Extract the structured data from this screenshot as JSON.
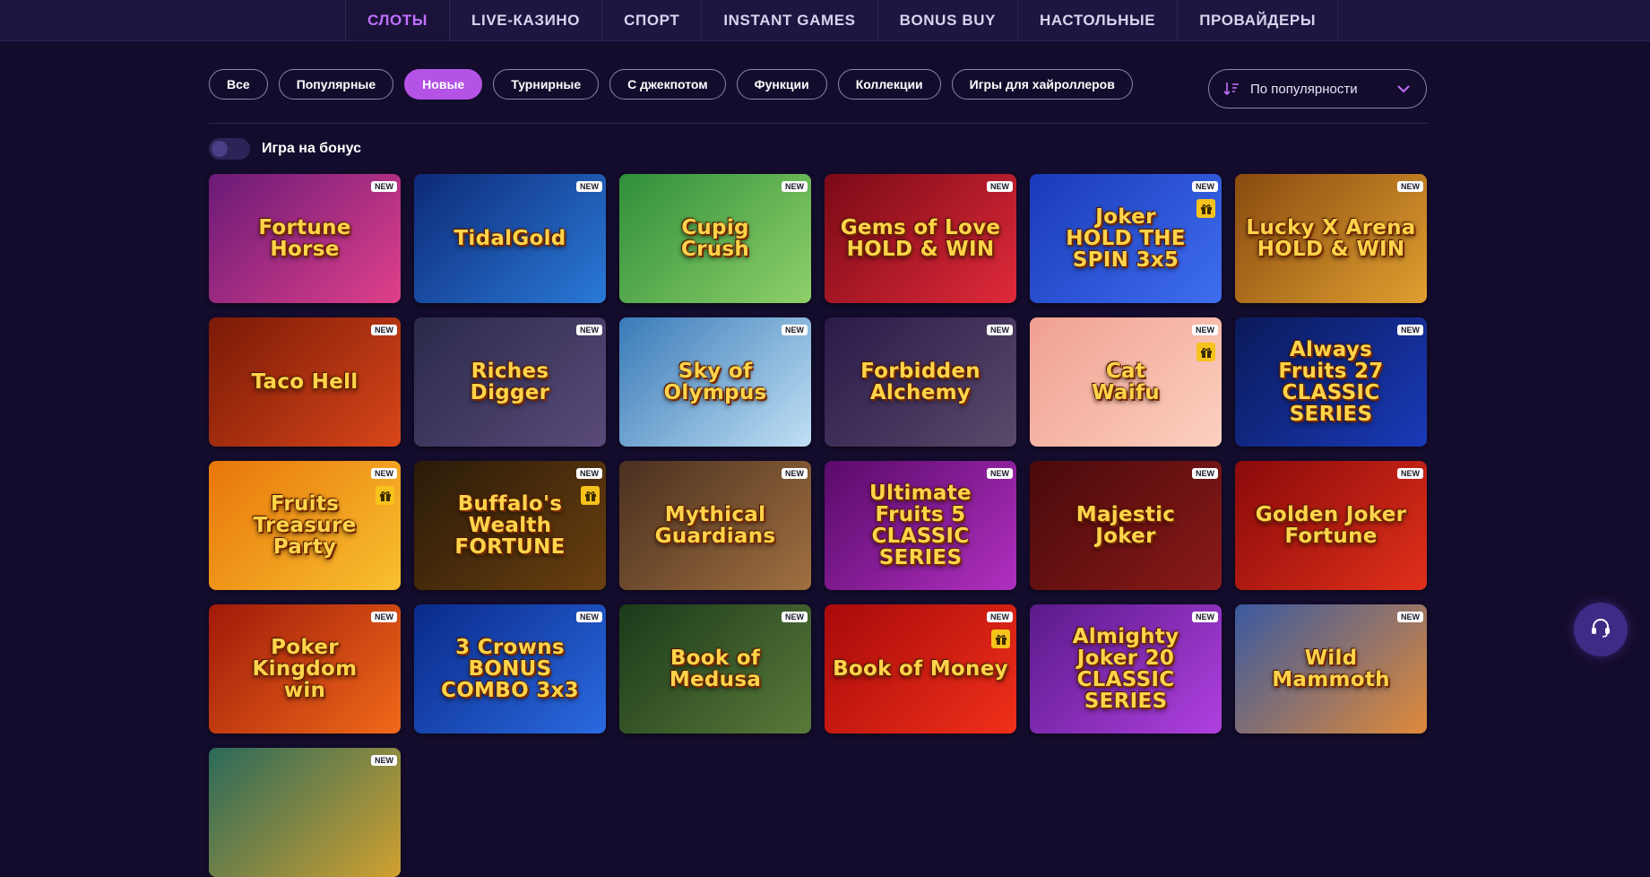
{
  "nav": {
    "tabs": [
      {
        "label": "СЛОТЫ",
        "active": true
      },
      {
        "label": "LIVE-КАЗИНО",
        "active": false
      },
      {
        "label": "СПОРТ",
        "active": false
      },
      {
        "label": "INSTANT GAMES",
        "active": false
      },
      {
        "label": "BONUS BUY",
        "active": false
      },
      {
        "label": "НАСТОЛЬНЫЕ",
        "active": false
      },
      {
        "label": "ПРОВАЙДЕРЫ",
        "active": false
      }
    ]
  },
  "filters": [
    {
      "label": "Все",
      "active": false
    },
    {
      "label": "Популярные",
      "active": false
    },
    {
      "label": "Новые",
      "active": true
    },
    {
      "label": "Турнирные",
      "active": false
    },
    {
      "label": "С джекпотом",
      "active": false
    },
    {
      "label": "Функции",
      "active": false
    },
    {
      "label": "Коллекции",
      "active": false
    },
    {
      "label": "Игры для хайроллеров",
      "active": false
    }
  ],
  "sort": {
    "label": "По популярности",
    "icon": "sort-descending-icon"
  },
  "bonus_toggle": {
    "label": "Игра на бонус",
    "on": false
  },
  "games": [
    {
      "title": "Fortune\nHorse",
      "badge": "NEW",
      "gift": false,
      "bg": [
        "#6a1a78",
        "#e0408a"
      ]
    },
    {
      "title": "TidalGold",
      "badge": "NEW",
      "gift": false,
      "bg": [
        "#0d2a78",
        "#2a7ad8"
      ]
    },
    {
      "title": "Cupig\nCrush",
      "badge": "NEW",
      "gift": false,
      "bg": [
        "#2f8f3a",
        "#8fd06a"
      ]
    },
    {
      "title": "Gems of Love\nHOLD & WIN",
      "badge": "NEW",
      "gift": false,
      "bg": [
        "#7a0a16",
        "#e02a3a"
      ]
    },
    {
      "title": "Joker\nHOLD THE SPIN 3x5",
      "badge": "NEW",
      "gift": true,
      "bg": [
        "#1a3ab8",
        "#3e6ef0"
      ]
    },
    {
      "title": "Lucky X Arena\nHOLD & WIN",
      "badge": "NEW",
      "gift": false,
      "bg": [
        "#8a4a10",
        "#e0a030"
      ]
    },
    {
      "title": "Taco Hell",
      "badge": "NEW",
      "gift": false,
      "bg": [
        "#7a1a06",
        "#d8461a"
      ]
    },
    {
      "title": "Riches\nDigger",
      "badge": "NEW",
      "gift": false,
      "bg": [
        "#2a2a4a",
        "#5a4a7a"
      ]
    },
    {
      "title": "Sky of\nOlympus",
      "badge": "NEW",
      "gift": false,
      "bg": [
        "#3a7ab8",
        "#c0e0f4"
      ]
    },
    {
      "title": "Forbidden\nAlchemy",
      "badge": "NEW",
      "gift": false,
      "bg": [
        "#2a1a4a",
        "#5a4a6a"
      ]
    },
    {
      "title": "Cat\nWaifu",
      "badge": "NEW",
      "gift": true,
      "bg": [
        "#f0a090",
        "#fcd0c0"
      ]
    },
    {
      "title": "Always\nFruits 27\nCLASSIC SERIES",
      "badge": "NEW",
      "gift": false,
      "bg": [
        "#0a1a5a",
        "#1a3ab8"
      ]
    },
    {
      "title": "Fruits\nTreasure\nParty",
      "badge": "NEW",
      "gift": true,
      "bg": [
        "#e8760a",
        "#f8c030"
      ]
    },
    {
      "title": "Buffalo's\nWealth\nFORTUNE",
      "badge": "NEW",
      "gift": true,
      "bg": [
        "#2a1a08",
        "#6a4010"
      ]
    },
    {
      "title": "Mythical\nGuardians",
      "badge": "NEW",
      "gift": false,
      "bg": [
        "#4a3020",
        "#a07040"
      ]
    },
    {
      "title": "Ultimate\nFruits 5\nCLASSIC SERIES",
      "badge": "NEW",
      "gift": false,
      "bg": [
        "#5a0a6a",
        "#b030c0"
      ]
    },
    {
      "title": "Majestic\nJoker",
      "badge": "NEW",
      "gift": false,
      "bg": [
        "#4a0a0a",
        "#8a1a1a"
      ]
    },
    {
      "title": "Golden Joker\nFortune",
      "badge": "NEW",
      "gift": false,
      "bg": [
        "#8a0a0a",
        "#e0301a"
      ]
    },
    {
      "title": "Poker\nKingdom\nwin",
      "badge": "NEW",
      "gift": false,
      "bg": [
        "#a01a0a",
        "#f06a1a"
      ]
    },
    {
      "title": "3 Crowns\nBONUS COMBO 3x3",
      "badge": "NEW",
      "gift": false,
      "bg": [
        "#0a2a8a",
        "#2a6ae0"
      ]
    },
    {
      "title": "Book of\nMedusa",
      "badge": "NEW",
      "gift": false,
      "bg": [
        "#1a3a1a",
        "#5a7a3a"
      ]
    },
    {
      "title": "Book of Money",
      "badge": "NEW",
      "gift": true,
      "bg": [
        "#a80a0a",
        "#f0301a"
      ]
    },
    {
      "title": "Almighty\nJoker 20\nCLASSIC SERIES",
      "badge": "NEW",
      "gift": false,
      "bg": [
        "#5a1a8a",
        "#b040e0"
      ]
    },
    {
      "title": "Wild\nMammoth",
      "badge": "NEW",
      "gift": false,
      "bg": [
        "#3a5aa0",
        "#e08a3a"
      ]
    },
    {
      "title": "",
      "badge": "NEW",
      "gift": false,
      "bg": [
        "#2a6a5a",
        "#d0a030"
      ]
    }
  ],
  "support_button": {
    "icon": "headset-icon"
  }
}
